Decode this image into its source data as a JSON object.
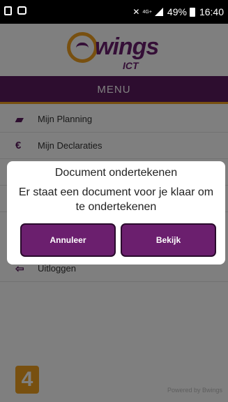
{
  "status_bar": {
    "network_label": "4G+",
    "battery": "49%",
    "time": "16:40"
  },
  "header": {
    "logo_main": "wings",
    "logo_sub": "ICT",
    "menu_title": "MENU"
  },
  "menu": {
    "items": [
      {
        "label": "Mijn Planning",
        "icon": "book-icon"
      },
      {
        "label": "Mijn Declaraties",
        "icon": "euro-icon"
      },
      {
        "label": "",
        "icon": ""
      },
      {
        "label": "",
        "icon": ""
      },
      {
        "label": "Uitloggen",
        "icon": "logout-icon"
      }
    ]
  },
  "footer": {
    "version_badge": "4",
    "powered_by": "Powered by Bwings"
  },
  "dialog": {
    "title": "Document ondertekenen",
    "message": "Er staat een document voor je klaar om te ondertekenen",
    "cancel_label": "Annuleer",
    "view_label": "Bekijk"
  },
  "colors": {
    "brand_purple": "#5b1a5e",
    "brand_orange": "#f0a020",
    "button_purple": "#6b1f6e"
  }
}
